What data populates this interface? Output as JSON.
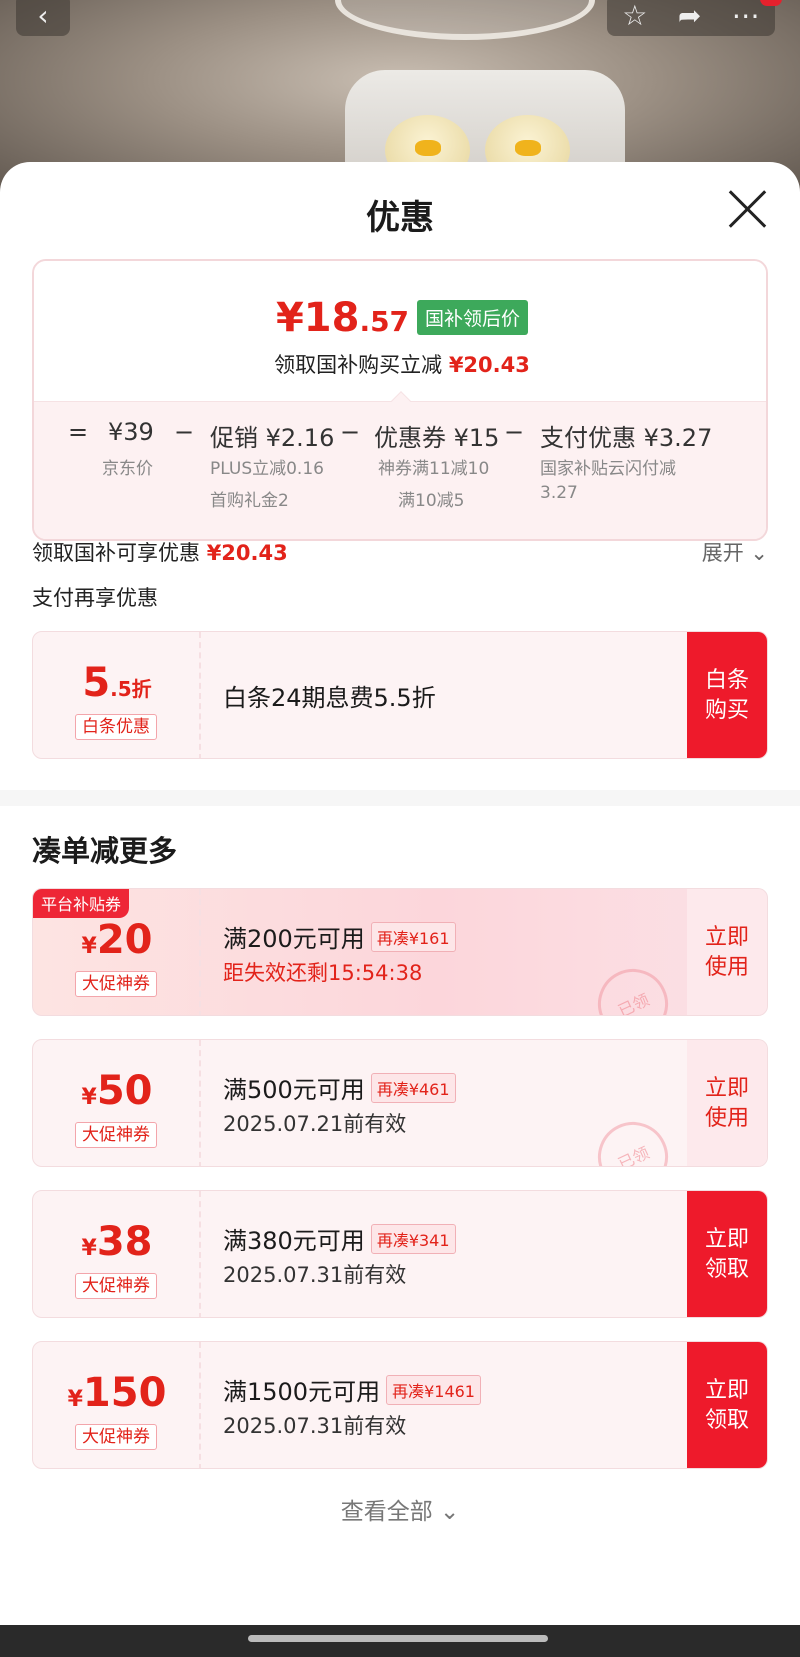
{
  "sheet": {
    "title": "优惠"
  },
  "price_card": {
    "final_price_int": "¥18",
    "final_price_dec": ".57",
    "tag": "国补领后价",
    "subtitle_prefix": "领取国补购买立减",
    "subtitle_amount": "¥20.43",
    "calc": {
      "eq": "=",
      "base_price": "¥39",
      "base_label": "京东价",
      "minus1": "−",
      "promo": "促销 ¥2.16",
      "promo_sub1": "PLUS立减0.16",
      "promo_sub2": "首购礼金2",
      "minus2": "−",
      "coupon": "优惠券 ¥15",
      "coupon_sub1": "神券满11减10",
      "coupon_sub2": "满10减5",
      "minus3": "−",
      "pay": "支付优惠 ¥3.27",
      "pay_sub1": "国家补贴云闪付减",
      "pay_sub2": "3.27"
    }
  },
  "gov_line": {
    "label": "领取国补可享优惠",
    "amount": "¥20.43",
    "expand": "展开"
  },
  "pay_line": {
    "label": "支付再享优惠"
  },
  "baitiao": {
    "value": "5",
    "value_dec": ".5折",
    "kind": "白条优惠",
    "desc": "白条24期息费5.5折",
    "action_l1": "白条",
    "action_l2": "购买"
  },
  "section": {
    "title": "凑单减更多"
  },
  "coupons": [
    {
      "platform_tag": "平台补贴券",
      "currency": "¥",
      "amount": "20",
      "kind": "大促神券",
      "condition": "满200元可用",
      "chip": "再凑¥161",
      "valid": "距失效还剩15:54:38",
      "action_l1": "立即",
      "action_l2": "使用",
      "stamp": "已领"
    },
    {
      "currency": "¥",
      "amount": "50",
      "kind": "大促神券",
      "condition": "满500元可用",
      "chip": "再凑¥461",
      "valid": "2025.07.21前有效",
      "action_l1": "立即",
      "action_l2": "使用",
      "stamp": "已领"
    },
    {
      "currency": "¥",
      "amount": "38",
      "kind": "大促神券",
      "condition": "满380元可用",
      "chip": "再凑¥341",
      "valid": "2025.07.31前有效",
      "action_l1": "立即",
      "action_l2": "领取"
    },
    {
      "currency": "¥",
      "amount": "150",
      "kind": "大促神券",
      "condition": "满1500元可用",
      "chip": "再凑¥1461",
      "valid": "2025.07.31前有效",
      "action_l1": "立即",
      "action_l2": "领取"
    }
  ],
  "view_all": "查看全部",
  "icons": {
    "back": "back-arrow-icon",
    "star": "star-icon",
    "share": "share-icon",
    "more": "more-icon",
    "close": "close-icon",
    "chevron": "chevron-down-icon"
  },
  "colors": {
    "accent_red": "#e2231a",
    "button_red": "#ee1a2b",
    "tag_green": "#3da95b"
  }
}
